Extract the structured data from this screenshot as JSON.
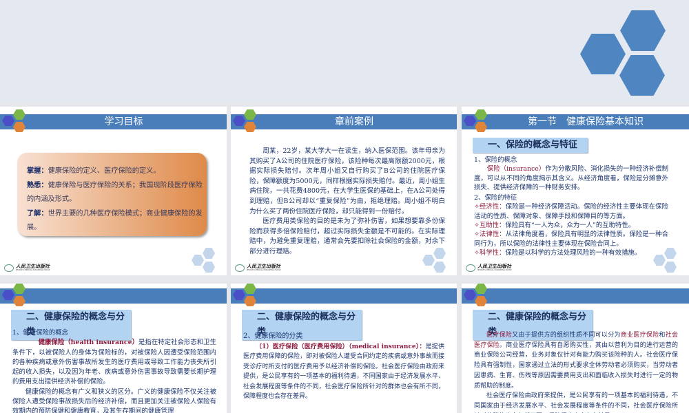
{
  "publisher": {
    "name_cn": "人民卫生出版社",
    "name_en": "PEOPLE'S MEDICAL PUBLISHING HOUSE"
  },
  "colors": {
    "header": "#4a7ebb",
    "accent_red": "#8c1a3c",
    "hex_blue": "#4f86c1",
    "hex_green": "#7ab648",
    "hex_orange": "#e0843a",
    "hex_purple": "#4a4fc8"
  },
  "slide1": {
    "title": "学习目标",
    "lines": [
      {
        "label": "掌握：",
        "text": "健康保险的定义、医疗保险的定义。"
      },
      {
        "label": "熟悉：",
        "text": "健康保险与医疗保险的关系；我国现阶段医疗保险的内涵及形式。"
      },
      {
        "label": "了解：",
        "text": "世界主要的几种医疗保险模式；商业健康保险的发展。"
      }
    ]
  },
  "slide2": {
    "title": "章前案例",
    "p1": "周某，22岁，某大学大一在读生，纳入医保范围。该年母亲为其购买了A公司的住院医疗保险，该险种每次最高限额2000元，根据实际损失赔付。次年周小姐又自行购买了B公司的住院医疗保险，保障额度为5000元，同样根据实际损失赔付。最近，周小姐生病住院，一共花费4800元，在大学生医保的基础上，在A公司处得到理赔，但B公司却以“重复保险”为由，拒绝理赔。周小姐不明白为什么买了两份住院医疗保险，却只能得到一份赔付。",
    "p2": "医疗费用类保险的目的是未为了弥补伤害，如果想要靠多份保险而获得多倍保险赔付，超过实际损失金额是不可能的。在实际理赔中，为避免重复理赔，通常会先要扣除社会保险的金额，对余下部分进行理赔。"
  },
  "slide3": {
    "title": "第一节　健康保险基本知识",
    "subtitle": "一、保险的概念与特征",
    "h1": "1、保险的概念",
    "term": "保险（insurance）",
    "def": "作为分散风险、消化损失的一种经济补偿制度，可以从不同的角度揭示其含义。从经济角度看，保险是分摊意外损失、提供经济保障的一种财务安排。",
    "h2": "2、保险的特征",
    "features": [
      {
        "name": "经济性：",
        "text": "保险是一种经济保障活动。保险的经济性主要体现在保险活动的性质、保障对象、保障手段和保障目的等方面。"
      },
      {
        "name": "互助性：",
        "text": "保险具有“一人为众，众为一人”的互助特性。"
      },
      {
        "name": "法律性：",
        "text": "从法律角度看，保险具有明显的法律性质。保险是一种合同行为，所以保险的法律性主要体现在保险合同上。"
      },
      {
        "name": "科学性：",
        "text": "保险是以科学的方法处理风险的一种有效措施。"
      }
    ]
  },
  "slide4": {
    "subtitle": "二、健康保险的概念与分类",
    "h1": "1、健康保险的概念",
    "term": "健康保险（health insurance）",
    "def": "是指在特定社会形态和卫生条件下，以被保险人的身体为保险标的，对被保险人因遭受保险范围内的各种疾病或意外伤害事故所发生的医疗费用或导致工作能力丧失所引起的收入损失，以及因为年老、疾病或意外伤害事故导致需要长期护理的费用支出提供经济补偿的保险。",
    "p2": "健康保险的概念有广义和狭义的区分。广义的健康保险不仅关注被保险人遭受保险事故损失后的经济补偿，而且更加关注被保险人保险有效期内的预防保健和健康教育，及其生存期间的健康管理"
  },
  "slide5": {
    "subtitle": "二、健康保险的概念与分类",
    "h1": "2、健康保险的分类",
    "term": "（1）医疗保险（医疗费用保险）（medical insurance）：",
    "def": "是提供医疗费用保障的保险，即对被保险人遭受合同约定的疾病或意外事故而接受诊疗时所支付的医疗费用予以经济补偿的保险。社会医疗保险由政府来提供，是公民享有的一项基本的福利待遇，不同国家由于经济发展水平、社会发展程度等条件的不同，社会医疗保险所针对的群体也会有所不同，保障程度也会存在差异。"
  },
  "slide6": {
    "subtitle": "二、健康保险的概念与分类",
    "t1": "医疗保险",
    "t2": "又由于提供方的组织性质不同可以分为",
    "t3": "商业医疗保险",
    "t4": "和",
    "t5": "社会医疗保险",
    "t6": "。商业医疗保险具有自愿购买性，其由以营利为目的进行运营的商业保险公司经营，业务对象仅针对有能力购买该险种的人。社会医疗保险具有强制性，国家通过立法的形式要求全体劳动者必须购买，当劳动者因患病、生育、伤残等原因需要费用支出和面临收入损失时进行一定的物质帮助的制度。",
    "p2": "社会医疗保险由政府来提供，是公民享有的一项基本的福利待遇，不同国家由于经济发展水平、社会发展程度等条件的不同，社会医疗保险所针对的群体也会有所不同，保障程度也会存在差异。"
  }
}
